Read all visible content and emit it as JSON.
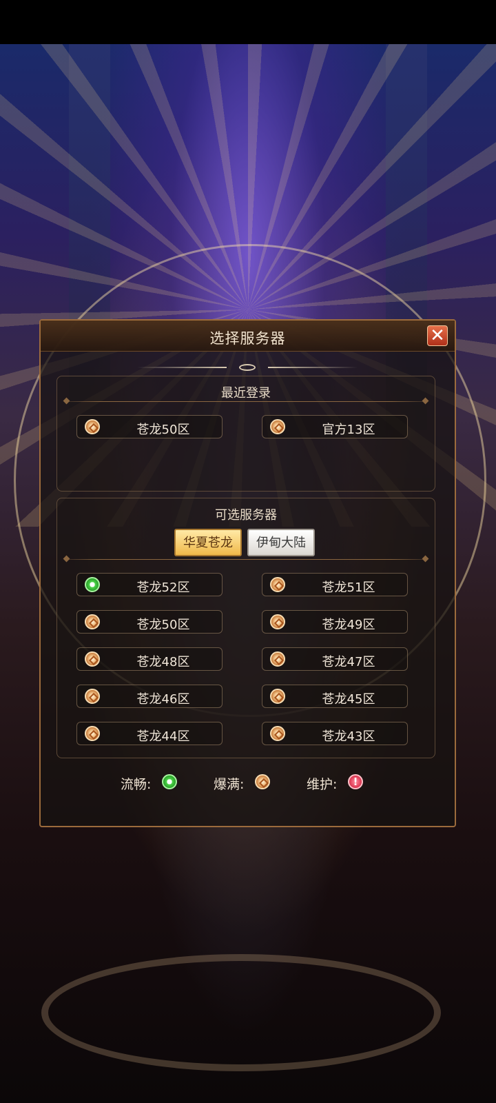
{
  "dialog": {
    "title": "选择服务器"
  },
  "recent": {
    "title": "最近登录",
    "servers": [
      {
        "label": "苍龙50区",
        "status": "full"
      },
      {
        "label": "官方13区",
        "status": "full"
      }
    ]
  },
  "available": {
    "title": "可选服务器",
    "tabs": [
      {
        "label": "华夏苍龙",
        "active": true
      },
      {
        "label": "伊甸大陆",
        "active": false
      }
    ],
    "servers": [
      {
        "label": "苍龙52区",
        "status": "smooth"
      },
      {
        "label": "苍龙51区",
        "status": "full"
      },
      {
        "label": "苍龙50区",
        "status": "full"
      },
      {
        "label": "苍龙49区",
        "status": "full"
      },
      {
        "label": "苍龙48区",
        "status": "full"
      },
      {
        "label": "苍龙47区",
        "status": "full"
      },
      {
        "label": "苍龙46区",
        "status": "full"
      },
      {
        "label": "苍龙45区",
        "status": "full"
      },
      {
        "label": "苍龙44区",
        "status": "full"
      },
      {
        "label": "苍龙43区",
        "status": "full"
      }
    ]
  },
  "legend": {
    "smooth": "流畅:",
    "full": "爆满:",
    "maintenance": "维护:"
  },
  "icons": {
    "close": "close-icon",
    "smooth": "smooth-status-icon",
    "full": "full-status-icon",
    "maintenance": "maintenance-status-icon"
  },
  "colors": {
    "accent_border": "#9c6b3c",
    "smooth": "#2aa02a",
    "full": "#c67a3a",
    "maintenance": "#e2405a",
    "tab_active": "#f0b94a"
  }
}
